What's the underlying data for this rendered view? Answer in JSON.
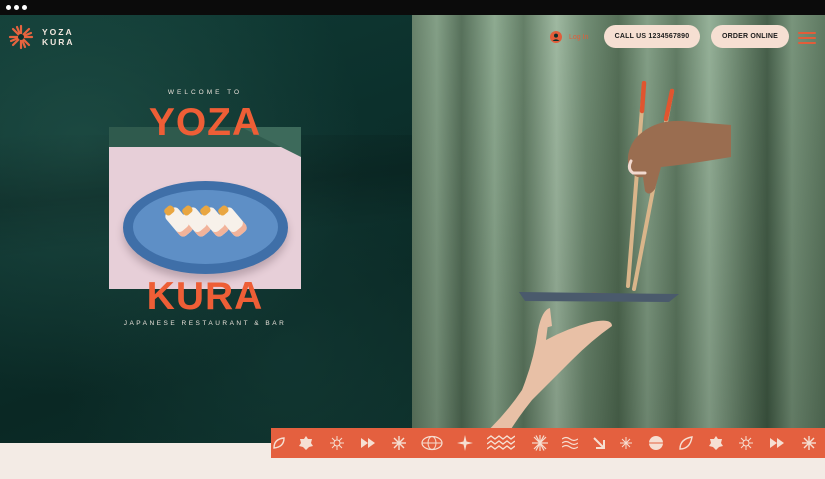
{
  "brand": {
    "name_line1": "YOZA",
    "name_line2": "KURA",
    "accent_color": "#ee5e36",
    "dark_green": "#0c302c",
    "pill_color": "#f6dfd2"
  },
  "header": {
    "login_label": "Log In",
    "call_label": "CALL US 1234567890",
    "order_label": "ORDER ONLINE"
  },
  "hero": {
    "welcome": "WELCOME TO",
    "title_top": "YOZA",
    "title_bottom": "KURA",
    "tagline": "JAPANESE RESTAURANT & BAR"
  },
  "icon_strip": {
    "icons": [
      "leaf-icon",
      "badge-icon",
      "sunburst-icon",
      "fast-forward-icon",
      "sunburst-icon",
      "globe-icon",
      "star-icon",
      "checker-icon",
      "sunburst-icon",
      "waves-icon",
      "arrow-down-right-icon",
      "spark-icon",
      "half-circle-icon",
      "leaf-icon",
      "badge-icon",
      "sunburst-icon",
      "fast-forward-icon",
      "sunburst-icon"
    ]
  }
}
